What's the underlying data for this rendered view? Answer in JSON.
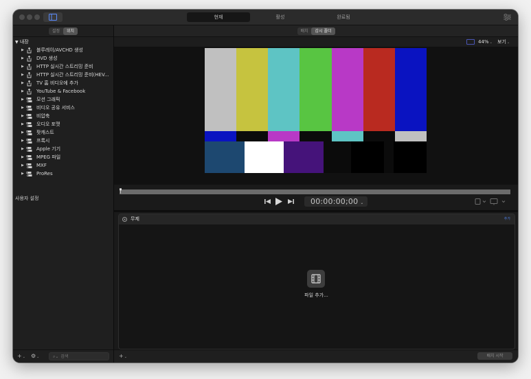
{
  "titlebar": {
    "tabs": [
      {
        "label": "현재",
        "active": true
      },
      {
        "label": "활성",
        "active": false
      },
      {
        "label": "완료됨",
        "active": false
      }
    ]
  },
  "left": {
    "segments": [
      {
        "label": "설정",
        "active": false
      },
      {
        "label": "위치",
        "active": true
      }
    ],
    "root_label": "내장",
    "items": [
      {
        "label": "블루레이/AVCHD 생성",
        "icon": "share-icon"
      },
      {
        "label": "DVD 생성",
        "icon": "share-icon"
      },
      {
        "label": "HTTP 실시간 스트리밍 준비",
        "icon": "share-icon"
      },
      {
        "label": "HTTP 실시간 스트리밍 준비(HEV...",
        "icon": "share-icon"
      },
      {
        "label": "TV 홈 비디오에 추가",
        "icon": "share-icon"
      },
      {
        "label": "YouTube & Facebook",
        "icon": "share-icon"
      },
      {
        "label": "모션 그래픽",
        "icon": "preset-stack-icon"
      },
      {
        "label": "비디오 공유 서비스",
        "icon": "preset-stack-icon"
      },
      {
        "label": "비압축",
        "icon": "preset-stack-icon"
      },
      {
        "label": "오디오 포맷",
        "icon": "preset-stack-icon"
      },
      {
        "label": "팟캐스트",
        "icon": "preset-stack-icon"
      },
      {
        "label": "프록시",
        "icon": "preset-stack-icon"
      },
      {
        "label": "Apple 기기",
        "icon": "preset-stack-icon"
      },
      {
        "label": "MPEG 파일",
        "icon": "preset-stack-icon"
      },
      {
        "label": "MXF",
        "icon": "preset-stack-icon"
      },
      {
        "label": "ProRes",
        "icon": "preset-stack-icon"
      }
    ],
    "custom_label": "사용자 설정",
    "search_placeholder": "검색"
  },
  "viewer": {
    "segments": [
      {
        "label": "배치",
        "active": false
      },
      {
        "label": "감시 폴더",
        "active": true
      }
    ],
    "zoom": "44%",
    "view_label": "보기",
    "timecode": "00:00:00;00",
    "colors": {
      "top": [
        "#c0c0c0",
        "#c6c33f",
        "#5ec4c4",
        "#58c542",
        "#b839c6",
        "#b92a20",
        "#0a13c1"
      ],
      "middle": [
        "#0a13c1",
        "#0b0b0b",
        "#b839c6",
        "#0b0b0b",
        "#5ec4c4",
        "#0b0b0b",
        "#c0c0c0"
      ],
      "bottom": [
        "#1d4870",
        "#ffffff",
        "#45137a",
        "#0b0b0b",
        "#000000",
        "#0b0b0b",
        "#000000"
      ]
    }
  },
  "batch": {
    "title": "무제",
    "add_label": "추가",
    "add_file_label": "파일 추가...",
    "start_label": "배치 시작"
  }
}
